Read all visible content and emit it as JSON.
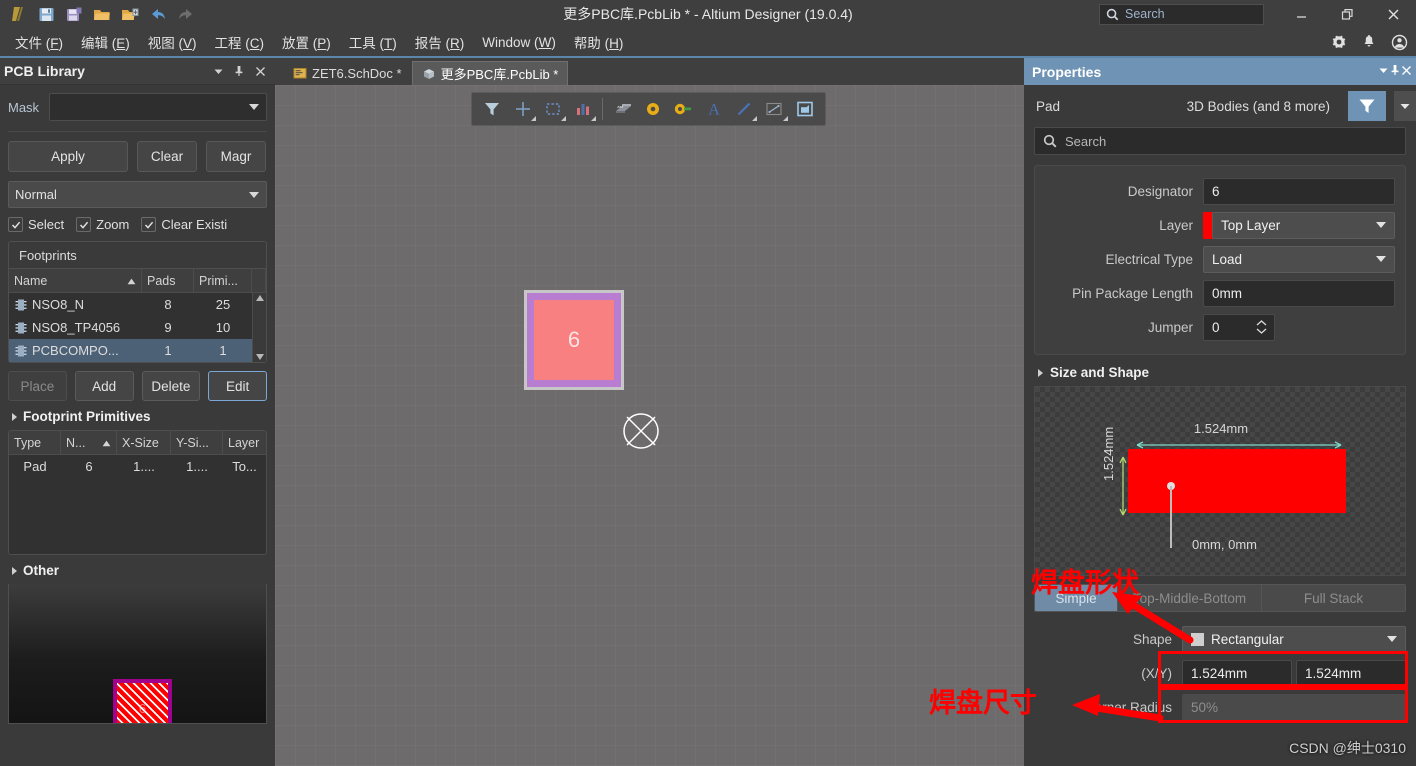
{
  "titlebar": {
    "title": "更多PBC库.PcbLib * - Altium Designer (19.0.4)",
    "search_placeholder": "Search",
    "icons": [
      "altium-logo-icon",
      "save-icon",
      "save-all-icon",
      "open-folder-icon",
      "open-project-icon",
      "undo-icon",
      "redo-icon"
    ],
    "minimize": "—",
    "restore": "❐",
    "close": "✕"
  },
  "menubar": {
    "items": [
      {
        "label": "文件 (",
        "key": "F",
        "tail": ")"
      },
      {
        "label": "编辑 (",
        "key": "E",
        "tail": ")"
      },
      {
        "label": "视图 (",
        "key": "V",
        "tail": ")"
      },
      {
        "label": "工程 (",
        "key": "C",
        "tail": ")"
      },
      {
        "label": "放置 (",
        "key": "P",
        "tail": ")"
      },
      {
        "label": "工具 (",
        "key": "T",
        "tail": ")"
      },
      {
        "label": "报告 (",
        "key": "R",
        "tail": ")"
      },
      {
        "label": "Window (",
        "key": "W",
        "tail": ")"
      },
      {
        "label": "帮助 (",
        "key": "H",
        "tail": ")"
      }
    ],
    "right_icons": [
      "gear-icon",
      "bell-icon",
      "user-account-icon"
    ]
  },
  "left_panel": {
    "title": "PCB Library",
    "mask_label": "Mask",
    "mask_value": "",
    "buttons": {
      "apply": "Apply",
      "clear": "Clear",
      "magnify": "Magr"
    },
    "mode_value": "Normal",
    "checkboxes": [
      {
        "label": "Select",
        "checked": true
      },
      {
        "label": "Zoom",
        "checked": true
      },
      {
        "label": "Clear Existi",
        "checked": true
      }
    ],
    "footprints": {
      "group_label": "Footprints",
      "columns": [
        "Name",
        "Pads",
        "Primi..."
      ],
      "rows": [
        {
          "name": "NSO8_N",
          "pads": "8",
          "primitives": "25",
          "selected": false
        },
        {
          "name": "NSO8_TP4056",
          "pads": "9",
          "primitives": "10",
          "selected": false
        },
        {
          "name": "PCBCOMPO...",
          "pads": "1",
          "primitives": "1",
          "selected": true
        }
      ],
      "action_buttons": [
        {
          "label": "Place",
          "disabled": true
        },
        {
          "label": "Add",
          "disabled": false
        },
        {
          "label": "Delete",
          "disabled": false
        },
        {
          "label": "Edit",
          "disabled": false,
          "focused": true
        }
      ]
    },
    "primitives": {
      "title": "Footprint Primitives",
      "columns": [
        "Type",
        "N...",
        "X-Size",
        "Y-Si...",
        "Layer"
      ],
      "rows": [
        {
          "type": "Pad",
          "n": "6",
          "xsize": "1....",
          "ysize": "1....",
          "layer": "To..."
        }
      ]
    },
    "other": {
      "title": "Other",
      "pad_designator": "6"
    }
  },
  "tabs": [
    {
      "label": "ZET6.SchDoc *",
      "icon": "schematic-doc-icon",
      "active": false
    },
    {
      "label": "更多PBC库.PcbLib *",
      "icon": "pcblib-doc-icon",
      "active": true
    }
  ],
  "canvas_toolbar": {
    "items": [
      {
        "name": "filter-tool-icon",
        "dropdown": false
      },
      {
        "name": "crosshair-place-icon",
        "dropdown": true
      },
      {
        "name": "selection-box-icon",
        "dropdown": true
      },
      {
        "name": "component-chart-icon",
        "dropdown": true
      },
      {
        "name": "footprint-ic-icon",
        "dropdown": false
      },
      {
        "name": "via-pad-icon",
        "dropdown": false
      },
      {
        "name": "pad-key-icon",
        "dropdown": false
      },
      {
        "name": "text-string-icon",
        "dropdown": false
      },
      {
        "name": "line-track-icon",
        "dropdown": true
      },
      {
        "name": "dimension-icon",
        "dropdown": true
      },
      {
        "name": "polygon-pour-icon",
        "dropdown": false
      }
    ]
  },
  "canvas": {
    "pad_label": "6"
  },
  "properties": {
    "title": "Properties",
    "object_type": "Pad",
    "object_selection": "3D Bodies (and 8 more)",
    "search_placeholder": "Search",
    "fields": [
      {
        "label": "Designator",
        "value": "6",
        "type": "text"
      },
      {
        "label": "Layer",
        "value": "Top Layer",
        "type": "combo",
        "swatch": "#ff0000"
      },
      {
        "label": "Electrical Type",
        "value": "Load",
        "type": "combo"
      },
      {
        "label": "Pin Package Length",
        "value": "0mm",
        "type": "text"
      },
      {
        "label": "Jumper",
        "value": "0",
        "type": "spinner"
      }
    ],
    "size_and_shape": {
      "title": "Size and Shape",
      "preview": {
        "width_label": "1.524mm",
        "height_label": "1.524mm",
        "origin_label": "0mm, 0mm",
        "pad_color": "#ff0000"
      },
      "stack_modes": [
        {
          "label": "Simple",
          "active": true
        },
        {
          "label": "Top-Middle-Bottom",
          "active": false
        },
        {
          "label": "Full Stack",
          "active": false
        }
      ],
      "shape_label": "Shape",
      "shape_value": "Rectangular",
      "xy_label": "(X/Y)",
      "x_value": "1.524mm",
      "y_value": "1.524mm",
      "corner_radius_label": "Corner Radius",
      "corner_radius_value": "50%"
    }
  },
  "annotations": {
    "shape_note": "焊盘形状",
    "size_note": "焊盘尺寸",
    "watermark": "CSDN @绅士0310",
    "color": "#ff0000"
  }
}
